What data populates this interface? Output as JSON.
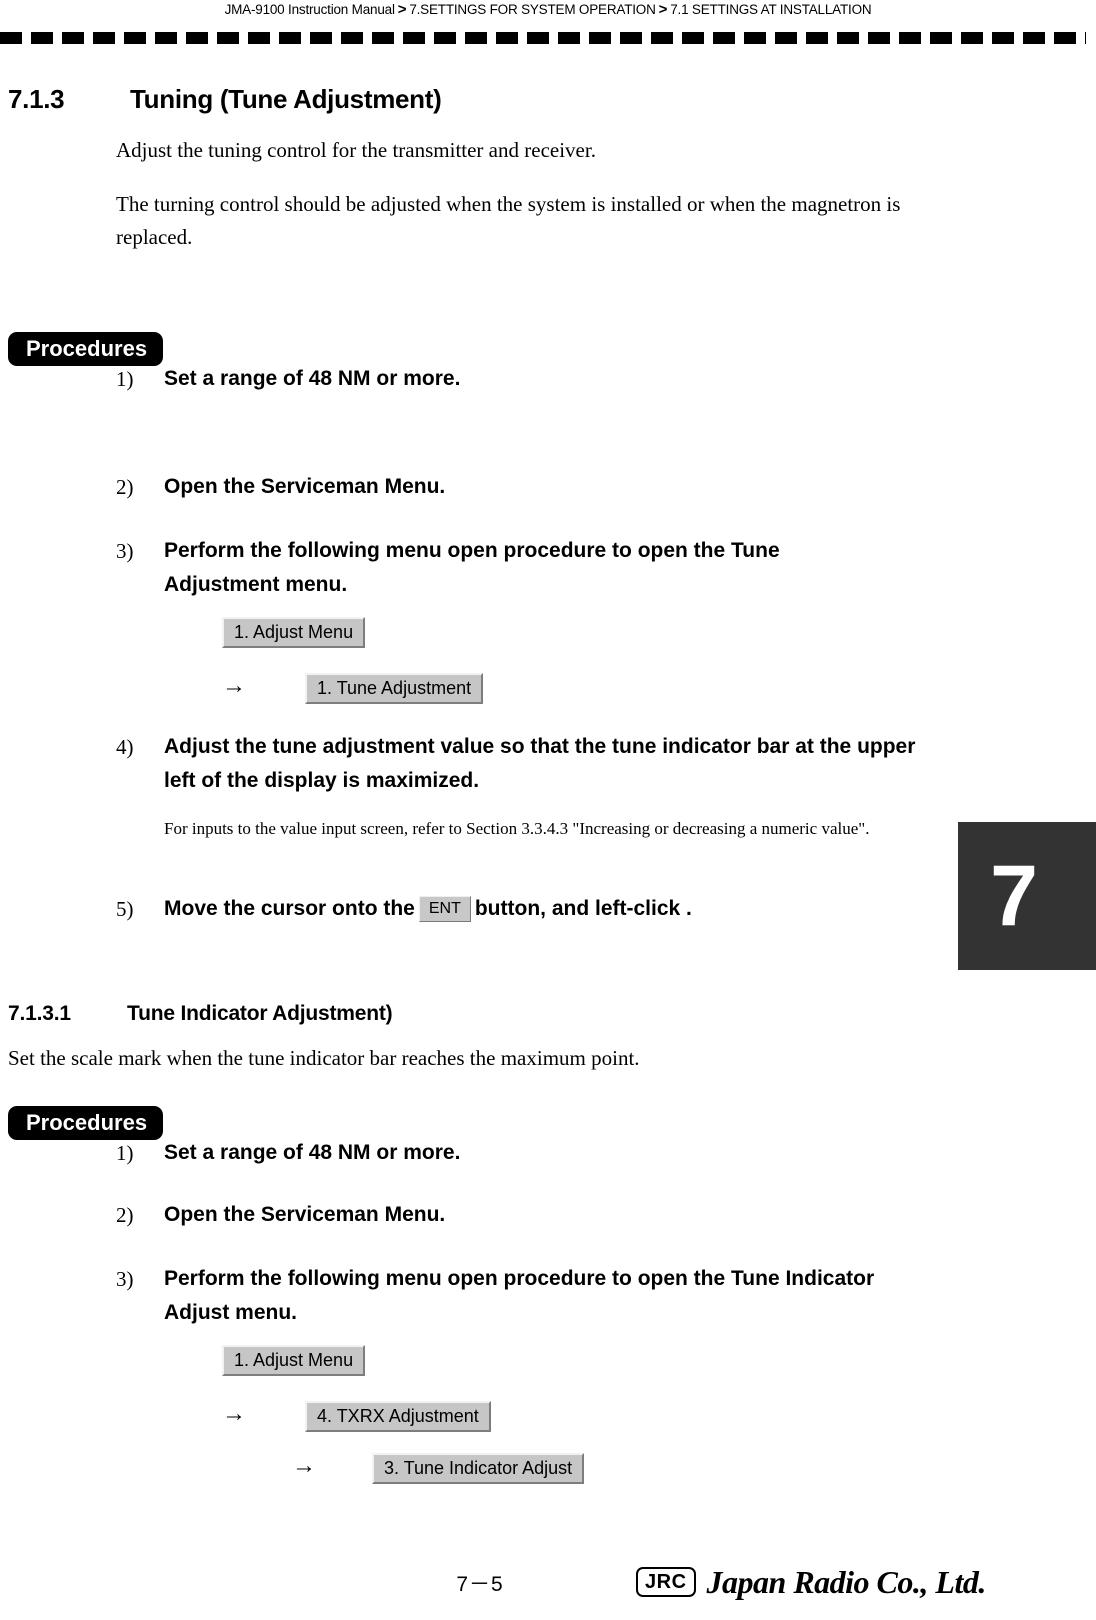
{
  "header": {
    "manual": "JMA-9100 Instruction Manual",
    "separator": ">",
    "chapter": "7.SETTINGS FOR SYSTEM OPERATION",
    "section": "7.1  SETTINGS AT INSTALLATION"
  },
  "chapter_tab": {
    "number": "7"
  },
  "section_713": {
    "number": "7.1.3",
    "title": "Tuning (Tune Adjustment)",
    "para1": "Adjust the tuning control for the transmitter and receiver.",
    "para2": "The turning control should be adjusted when the system is installed or when the magnetron is replaced.",
    "procedures_label": "Procedures",
    "steps": [
      {
        "num": "1)",
        "text": "Set a range of 48 NM or more."
      },
      {
        "num": "2)",
        "text": "Open the Serviceman Menu."
      },
      {
        "num": "3)",
        "text": "Perform the following menu open procedure to open the Tune Adjustment menu."
      },
      {
        "num": "4)",
        "text": "Adjust the tune adjustment value so that the tune indicator bar at the upper left of the display is maximized."
      },
      {
        "num": "5)",
        "text_before": "Move the cursor onto the",
        "keycap": "ENT",
        "text_after": "button, and left-click ."
      }
    ],
    "note": "For inputs to the value input screen, refer to Section 3.3.4.3 \"Increasing or decreasing a numeric value\".",
    "menu_path": [
      {
        "label": "1. Adjust Menu",
        "arrow": ""
      },
      {
        "label": "1. Tune Adjustment",
        "arrow": "→"
      }
    ]
  },
  "section_7131": {
    "number": "7.1.3.1",
    "title": "Tune Indicator Adjustment)",
    "para1": "Set the scale mark when the tune indicator bar reaches the maximum point.",
    "procedures_label": "Procedures",
    "steps": [
      {
        "num": "1)",
        "text": "Set a range of 48 NM or more."
      },
      {
        "num": "2)",
        "text": "Open the Serviceman Menu."
      },
      {
        "num": "3)",
        "text": "Perform the following menu open procedure to open the Tune Indicator Adjust menu."
      }
    ],
    "menu_path": [
      {
        "label": "1. Adjust Menu",
        "arrow": ""
      },
      {
        "label": "4. TXRX Adjustment",
        "arrow": "→"
      },
      {
        "label": "3. Tune Indicator Adjust",
        "arrow": "→"
      }
    ]
  },
  "footer": {
    "page_number": "7－5",
    "logo_mark": "JRC",
    "logo_wordmark": "Japan Radio Co., Ltd."
  }
}
